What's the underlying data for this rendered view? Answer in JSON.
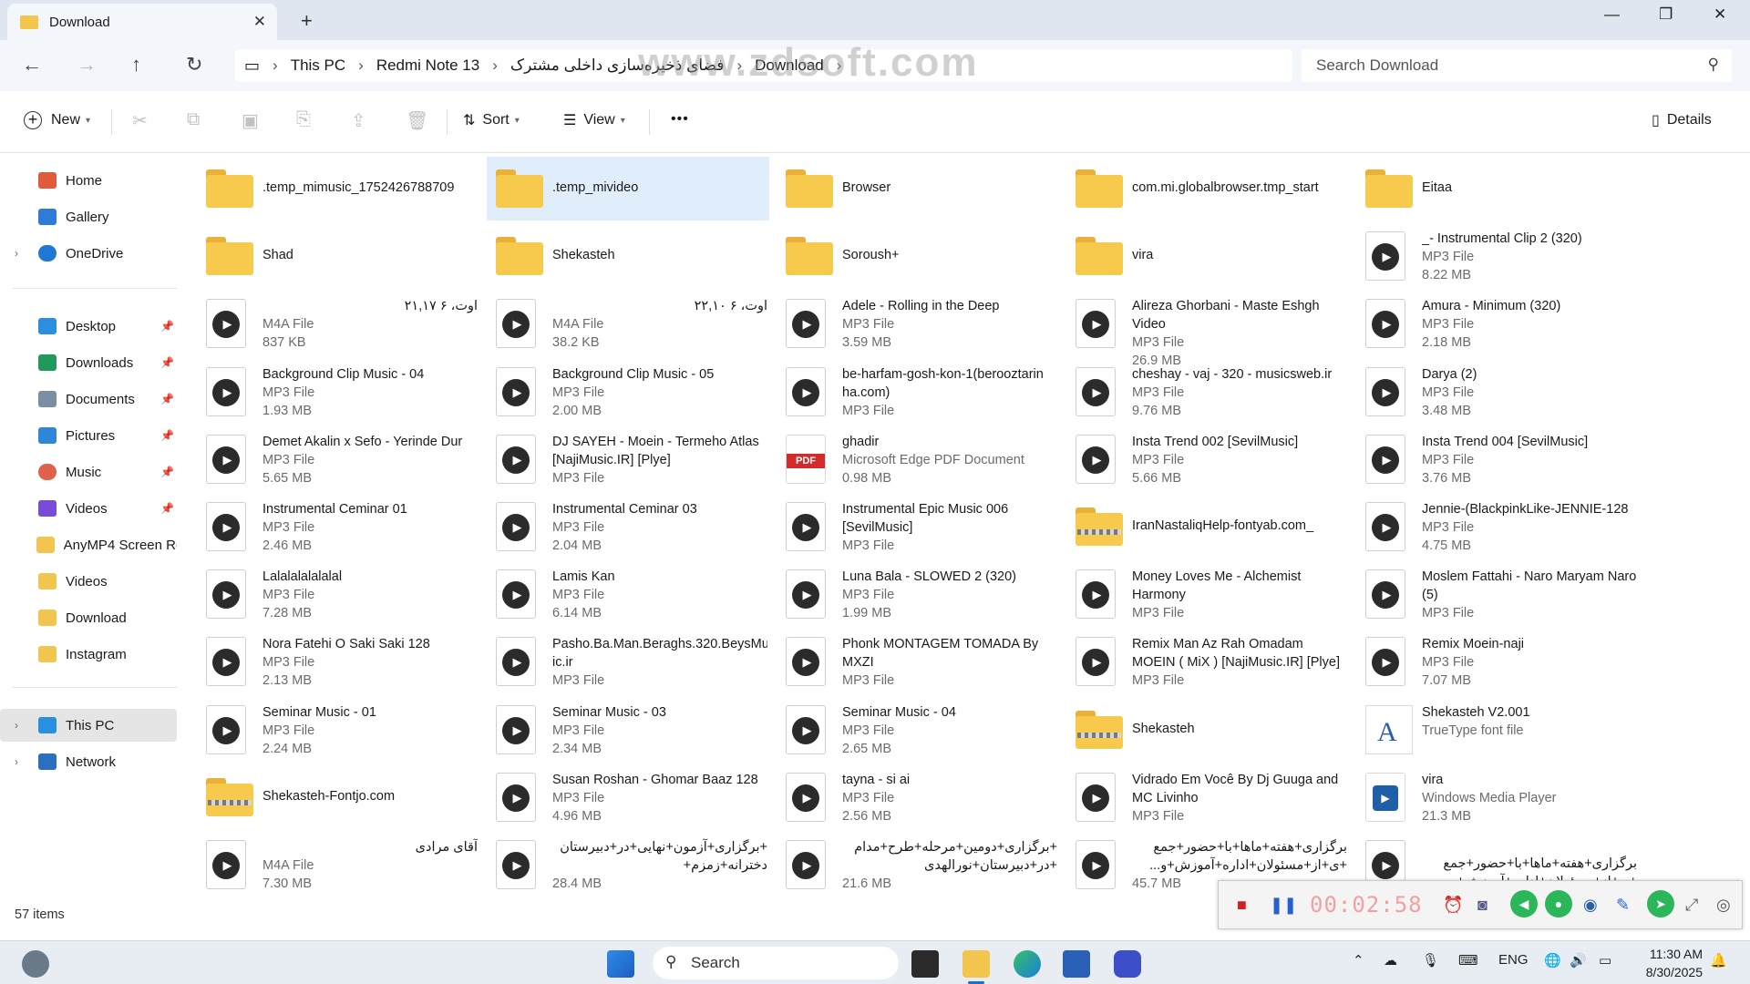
{
  "window": {
    "tab_title": "Download",
    "new_tab": "+",
    "close_tab": "✕",
    "minimize": "—",
    "maximize": "❐",
    "close": "✕"
  },
  "address": {
    "crumbs": [
      "This PC",
      "Redmi Note 13",
      "فضای ذخیره‌سازی داخلی مشترک",
      "Download"
    ],
    "separator": "›",
    "watermark": "www.zdsoft.com",
    "search_placeholder": "Search Download"
  },
  "commands": {
    "new": "New",
    "sort": "Sort",
    "view": "View",
    "more": "•••",
    "details": "Details"
  },
  "sidebar": {
    "top": [
      {
        "label": "Home",
        "icon": "home-icon",
        "color": "#e15b3a"
      },
      {
        "label": "Gallery",
        "icon": "gallery-icon",
        "color": "#2f7bd8"
      },
      {
        "label": "OneDrive",
        "icon": "cloud-icon",
        "color": "#1e78d4"
      }
    ],
    "pinned": [
      {
        "label": "Desktop",
        "icon": "desktop-icon",
        "color": "#2a8fe0"
      },
      {
        "label": "Downloads",
        "icon": "download-icon",
        "color": "#1f9a5a"
      },
      {
        "label": "Documents",
        "icon": "documents-icon",
        "color": "#7c8ea6"
      },
      {
        "label": "Pictures",
        "icon": "pictures-icon",
        "color": "#2d86d8"
      },
      {
        "label": "Music",
        "icon": "music-icon",
        "color": "#e0604a"
      },
      {
        "label": "Videos",
        "icon": "videos-icon",
        "color": "#7a4ad8"
      }
    ],
    "folders": [
      {
        "label": "AnyMP4 Screen Rec"
      },
      {
        "label": "Videos"
      },
      {
        "label": "Download"
      },
      {
        "label": "Instagram"
      }
    ],
    "bottom": [
      {
        "label": "This PC",
        "icon": "pc-icon"
      },
      {
        "label": "Network",
        "icon": "network-icon"
      }
    ]
  },
  "items": [
    {
      "name": ".temp_mimusic_1752426788709",
      "type": "",
      "size": "",
      "icon": "folder"
    },
    {
      "name": ".temp_mivideo",
      "type": "",
      "size": "",
      "icon": "folder"
    },
    {
      "name": "Browser",
      "type": "",
      "size": "",
      "icon": "folder"
    },
    {
      "name": "com.mi.globalbrowser.tmp_start",
      "type": "",
      "size": "",
      "icon": "folder"
    },
    {
      "name": "Eitaa",
      "type": "",
      "size": "",
      "icon": "folder"
    },
    {
      "name": "Shad",
      "type": "",
      "size": "",
      "icon": "folder"
    },
    {
      "name": "Shekasteh",
      "type": "",
      "size": "",
      "icon": "folder"
    },
    {
      "name": "Soroush+",
      "type": "",
      "size": "",
      "icon": "folder"
    },
    {
      "name": "vira",
      "type": "",
      "size": "",
      "icon": "folder"
    },
    {
      "name": "_- Instrumental Clip 2 (320)",
      "type": "MP3 File",
      "size": "8.22 MB",
      "icon": "media"
    },
    {
      "name": "اوت، ۶ ۲۱,۱۷",
      "type": "M4A File",
      "size": "837 KB",
      "icon": "media"
    },
    {
      "name": "اوت، ۶ ۲۲,۱۰",
      "type": "M4A File",
      "size": "38.2 KB",
      "icon": "media"
    },
    {
      "name": "Adele - Rolling in the Deep",
      "type": "MP3 File",
      "size": "3.59 MB",
      "icon": "media"
    },
    {
      "name": "Alireza Ghorbani - Maste Eshgh Video",
      "type": "MP3 File",
      "size": "26.9 MB",
      "icon": "media"
    },
    {
      "name": "Amura - Minimum (320)",
      "type": "MP3 File",
      "size": "2.18 MB",
      "icon": "media"
    },
    {
      "name": "Background Clip Music - 04",
      "type": "MP3 File",
      "size": "1.93 MB",
      "icon": "media"
    },
    {
      "name": "Background Clip Music - 05",
      "type": "MP3 File",
      "size": "2.00 MB",
      "icon": "media"
    },
    {
      "name": "be-harfam-gosh-kon-1(berooztarin ha.com)",
      "type": "MP3 File",
      "size": "",
      "icon": "media"
    },
    {
      "name": "cheshay - vaj - 320 - musicsweb.ir",
      "type": "MP3 File",
      "size": "9.76 MB",
      "icon": "media"
    },
    {
      "name": "Darya (2)",
      "type": "MP3 File",
      "size": "3.48 MB",
      "icon": "media"
    },
    {
      "name": "Demet Akalin x Sefo - Yerinde Dur",
      "type": "MP3 File",
      "size": "5.65 MB",
      "icon": "media"
    },
    {
      "name": "DJ SAYEH - Moein - Termeho Atlas [NajiMusic.IR] [Plye]",
      "type": "MP3 File",
      "size": "",
      "icon": "media"
    },
    {
      "name": "ghadir",
      "type": "Microsoft Edge PDF Document",
      "size": "0.98 MB",
      "icon": "pdf"
    },
    {
      "name": "Insta Trend 002 [SevilMusic]",
      "type": "MP3 File",
      "size": "5.66 MB",
      "icon": "media"
    },
    {
      "name": "Insta Trend 004 [SevilMusic]",
      "type": "MP3 File",
      "size": "3.76 MB",
      "icon": "media"
    },
    {
      "name": "Instrumental Ceminar 01",
      "type": "MP3 File",
      "size": "2.46 MB",
      "icon": "media"
    },
    {
      "name": "Instrumental Ceminar 03",
      "type": "MP3 File",
      "size": "2.04 MB",
      "icon": "media"
    },
    {
      "name": "Instrumental Epic Music 006 [SevilMusic]",
      "type": "MP3 File",
      "size": "",
      "icon": "media"
    },
    {
      "name": "IranNastaliqHelp-fontyab.com_",
      "type": "",
      "size": "",
      "icon": "zip"
    },
    {
      "name": "Jennie-(BlackpinkLike-JENNIE-128",
      "type": "MP3 File",
      "size": "4.75 MB",
      "icon": "media"
    },
    {
      "name": "Lalalalalalalal",
      "type": "MP3 File",
      "size": "7.28 MB",
      "icon": "media"
    },
    {
      "name": "Lamis Kan",
      "type": "MP3 File",
      "size": "6.14 MB",
      "icon": "media"
    },
    {
      "name": "Luna Bala - SLOWED 2 (320)",
      "type": "MP3 File",
      "size": "1.99 MB",
      "icon": "media"
    },
    {
      "name": "Money Loves Me - Alchemist Harmony",
      "type": "MP3 File",
      "size": "",
      "icon": "media"
    },
    {
      "name": "Moslem Fattahi - Naro Maryam Naro (5)",
      "type": "MP3 File",
      "size": "",
      "icon": "media"
    },
    {
      "name": "Nora Fatehi O Saki Saki 128",
      "type": "MP3 File",
      "size": "2.13 MB",
      "icon": "media"
    },
    {
      "name": "Pasho.Ba.Man.Beraghs.320.BeysMus ic.ir",
      "type": "MP3 File",
      "size": "",
      "icon": "media"
    },
    {
      "name": "Phonk MONTAGEM TOMADA By MXZI",
      "type": "MP3 File",
      "size": "",
      "icon": "media"
    },
    {
      "name": "Remix Man Az Rah Omadam MOEIN ( MiX ) [NajiMusic.IR] [Plye]",
      "type": "MP3 File",
      "size": "",
      "icon": "media"
    },
    {
      "name": "Remix Moein-naji",
      "type": "MP3 File",
      "size": "7.07 MB",
      "icon": "media"
    },
    {
      "name": "Seminar Music - 01",
      "type": "MP3 File",
      "size": "2.24 MB",
      "icon": "media"
    },
    {
      "name": "Seminar Music - 03",
      "type": "MP3 File",
      "size": "2.34 MB",
      "icon": "media"
    },
    {
      "name": "Seminar Music - 04",
      "type": "MP3 File",
      "size": "2.65 MB",
      "icon": "media"
    },
    {
      "name": "Shekasteh",
      "type": "",
      "size": "",
      "icon": "zip"
    },
    {
      "name": "Shekasteh V2.001",
      "type": "TrueType font file",
      "size": "",
      "icon": "font"
    },
    {
      "name": "Shekasteh-Fontjo.com",
      "type": "",
      "size": "",
      "icon": "zip"
    },
    {
      "name": "Susan Roshan - Ghomar Baaz 128",
      "type": "MP3 File",
      "size": "4.96 MB",
      "icon": "media"
    },
    {
      "name": "tayna - si ai",
      "type": "MP3 File",
      "size": "2.56 MB",
      "icon": "media"
    },
    {
      "name": "Vidrado Em Você By Dj Guuga and MC Livinho",
      "type": "MP3 File",
      "size": "",
      "icon": "media"
    },
    {
      "name": "vira",
      "type": "Windows Media Player",
      "size": "21.3 MB",
      "icon": "wmp"
    },
    {
      "name": "آقای مرادی",
      "type": "M4A File",
      "size": "7.30 MB",
      "icon": "media"
    },
    {
      "name": "+برگزاری+آزمون+نهایی+در+دبیرستان دخترانه+زمزم+",
      "type": "",
      "size": "28.4 MB",
      "icon": "media"
    },
    {
      "name": "+برگزاری+دومین+مرحله+طرح+مدام +در+دبیرستان+نورالهدی",
      "type": "",
      "size": "21.6 MB",
      "icon": "media"
    },
    {
      "name": "برگزاری+هفته+ماها+با+حضور+جمع +ی+از+مسئولان+اداره+آموزش+و...",
      "type": "",
      "size": "45.7 MB",
      "icon": "media"
    },
    {
      "name": "برگزاری+هفته+ماها+با+حضور+جمع +ی+از+مسئولان+اداره+آموزش+و...",
      "type": "",
      "size": "",
      "icon": "media"
    }
  ],
  "status": {
    "count": "57 items"
  },
  "recorder": {
    "time": "00:02:58"
  },
  "taskbar": {
    "search": "Search",
    "language": "ENG",
    "time": "11:30 AM",
    "date": "8/30/2025"
  }
}
